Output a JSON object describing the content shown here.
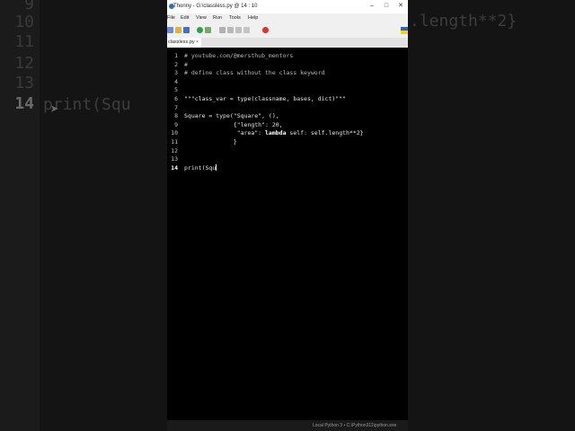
{
  "background": {
    "line_numbers": [
      "9",
      "10",
      "11",
      "12",
      "13",
      "14"
    ],
    "current_line": "14",
    "code_fragment": "print(Squ",
    "right_fragment": ".length**2}"
  },
  "window": {
    "title": "Thonny  -  G:\\classless.py  @  14 : 10",
    "controls": {
      "minimize": "–",
      "maximize": "□",
      "close": "✕"
    }
  },
  "menu": [
    "File",
    "Edit",
    "View",
    "Run",
    "Tools",
    "Help"
  ],
  "tab": {
    "label": "classless.py",
    "close": "×"
  },
  "editor": {
    "lines": [
      {
        "n": "1",
        "text": "# youtube.com/@mersthub_mentors"
      },
      {
        "n": "2",
        "text": "#"
      },
      {
        "n": "3",
        "text": "# define class without the class keyword"
      },
      {
        "n": "4",
        "text": ""
      },
      {
        "n": "5",
        "text": ""
      },
      {
        "n": "6",
        "text": "\"\"\"class_var = type(classname, bases, dict)\"\"\""
      },
      {
        "n": "7",
        "text": ""
      },
      {
        "n": "8",
        "text": "Square = type(\"Square\", (),"
      },
      {
        "n": "9",
        "text": "              {\"length\": 20,"
      },
      {
        "n": "10",
        "text": "               \"area\": "
      },
      {
        "n": "11",
        "text": "              }"
      },
      {
        "n": "12",
        "text": ""
      },
      {
        "n": "13",
        "text": ""
      },
      {
        "n": "14",
        "text": "print(Squ"
      }
    ],
    "line10_kw": "lambda",
    "line10_rest": " self: self.length**2}",
    "current_line": "14"
  },
  "status": {
    "interpreter": "Local Python 3  •  C:\\Python311\\python.exe"
  },
  "colors": {
    "editor_bg": "#000000",
    "chrome_bg": "#f0f0f0",
    "run_green": "#2ea043",
    "stop_red": "#d9342b"
  }
}
